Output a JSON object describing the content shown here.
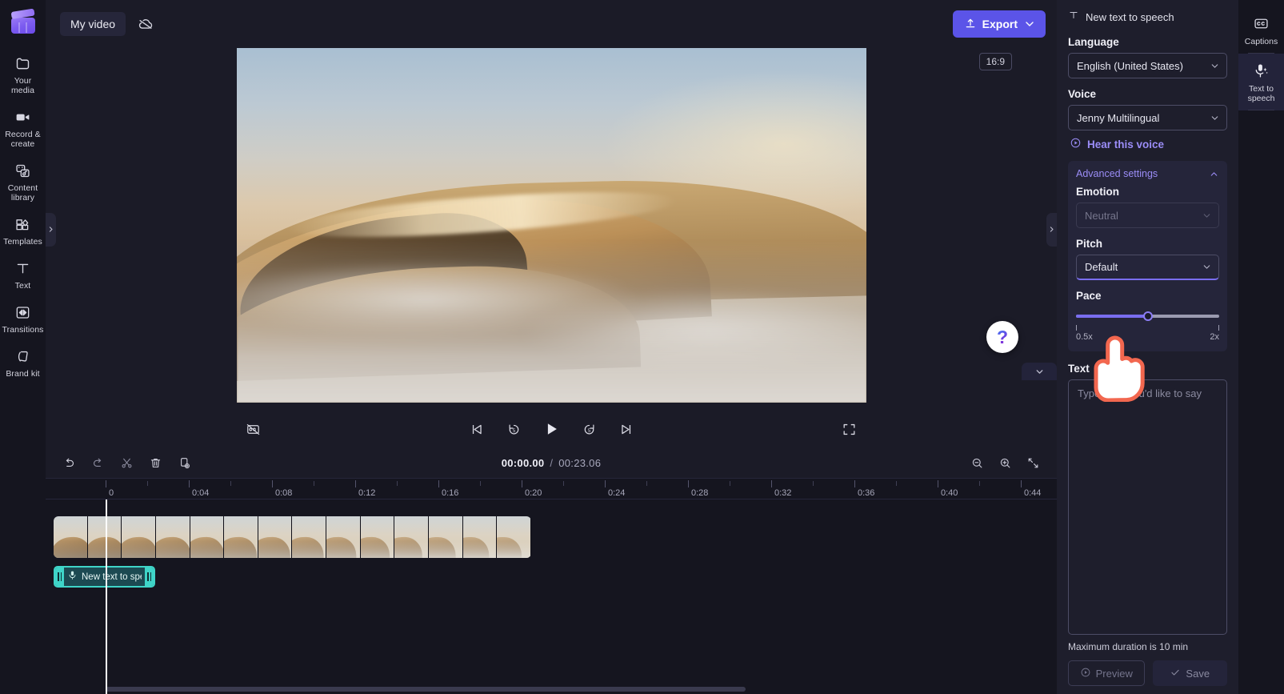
{
  "app": {
    "brand": "clipchamp-logo"
  },
  "left_rail": {
    "items": [
      {
        "label": "Your media",
        "icon": "folder-icon",
        "name": "your-media"
      },
      {
        "label": "Record &\ncreate",
        "icon": "video-camera-icon",
        "name": "record-and-create"
      },
      {
        "label": "Content\nlibrary",
        "icon": "content-library-icon",
        "name": "content-library"
      },
      {
        "label": "Templates",
        "icon": "templates-icon",
        "name": "templates"
      },
      {
        "label": "Text",
        "icon": "text-t-icon",
        "name": "text"
      },
      {
        "label": "Transitions",
        "icon": "transitions-icon",
        "name": "transitions"
      },
      {
        "label": "Brand kit",
        "icon": "brand-kit-icon",
        "name": "brand-kit"
      }
    ]
  },
  "topbar": {
    "project_name": "My video",
    "cloud_icon": "cloud-off-icon",
    "export_label": "Export",
    "export_icon": "upload-arrow-icon",
    "export_color": "#5b54e8"
  },
  "preview": {
    "aspect_ratio": "16:9",
    "help_glyph": "?",
    "controls": {
      "captions_off": "cc-off-icon",
      "skip_start": "skip-to-start-icon",
      "rewind_5": "rewind-5-icon",
      "play": "play-icon",
      "forward_5": "forward-5-icon",
      "skip_end": "skip-to-end-icon",
      "fullscreen": "fullscreen-icon"
    }
  },
  "timeline": {
    "tools": [
      {
        "name": "undo",
        "icon": "undo-icon"
      },
      {
        "name": "redo",
        "icon": "redo-icon"
      },
      {
        "name": "split",
        "icon": "scissors-icon"
      },
      {
        "name": "delete",
        "icon": "trash-icon"
      },
      {
        "name": "duplicate",
        "icon": "duplicate-icon"
      }
    ],
    "current_time": "00:00.00",
    "separator": "/",
    "total_time": "00:23.06",
    "zoom_out_icon": "zoom-out-icon",
    "zoom_in_icon": "zoom-in-icon",
    "fit_icon": "fit-to-timeline-icon",
    "ruler_labels": [
      "0",
      "0:04",
      "0:08",
      "0:12",
      "0:16",
      "0:20",
      "0:24",
      "0:28",
      "0:32",
      "0:36",
      "0:40",
      "0:44"
    ],
    "video_clip": {
      "name": "video-clip",
      "thumb_count": 14
    },
    "audio_clip": {
      "label": "New text to speech",
      "icon": "microphone-icon",
      "accent": "#3fd4c8"
    }
  },
  "panel": {
    "header_title": "New text to speech",
    "header_icon": "text-t-icon",
    "language_label": "Language",
    "language_value": "English (United States)",
    "voice_label": "Voice",
    "voice_value": "Jenny Multilingual",
    "hear_voice_label": "Hear this voice",
    "hear_voice_icon": "play-circle-icon",
    "advanced_label": "Advanced settings",
    "advanced_chevron": "chevron-up-icon",
    "emotion_label": "Emotion",
    "emotion_value": "Neutral",
    "pitch_label": "Pitch",
    "pitch_value": "Default",
    "pace_label": "Pace",
    "pace_min": "0.5x",
    "pace_max": "2x",
    "pace_value_pct": 50,
    "accent": "#7a6ef0",
    "text_label": "Text",
    "text_value": "",
    "text_placeholder": "Type what you'd like to say",
    "max_duration_note": "Maximum duration is 10 min",
    "preview_label": "Preview",
    "preview_icon": "play-circle-icon",
    "save_label": "Save",
    "save_icon": "checkmark-icon"
  },
  "right_rail": {
    "items": [
      {
        "label": "Captions",
        "icon": "cc-icon",
        "name": "captions",
        "active": false
      },
      {
        "label": "Text to\nspeech",
        "icon": "mic-sparkle-icon",
        "name": "text-to-speech",
        "active": true
      }
    ]
  }
}
